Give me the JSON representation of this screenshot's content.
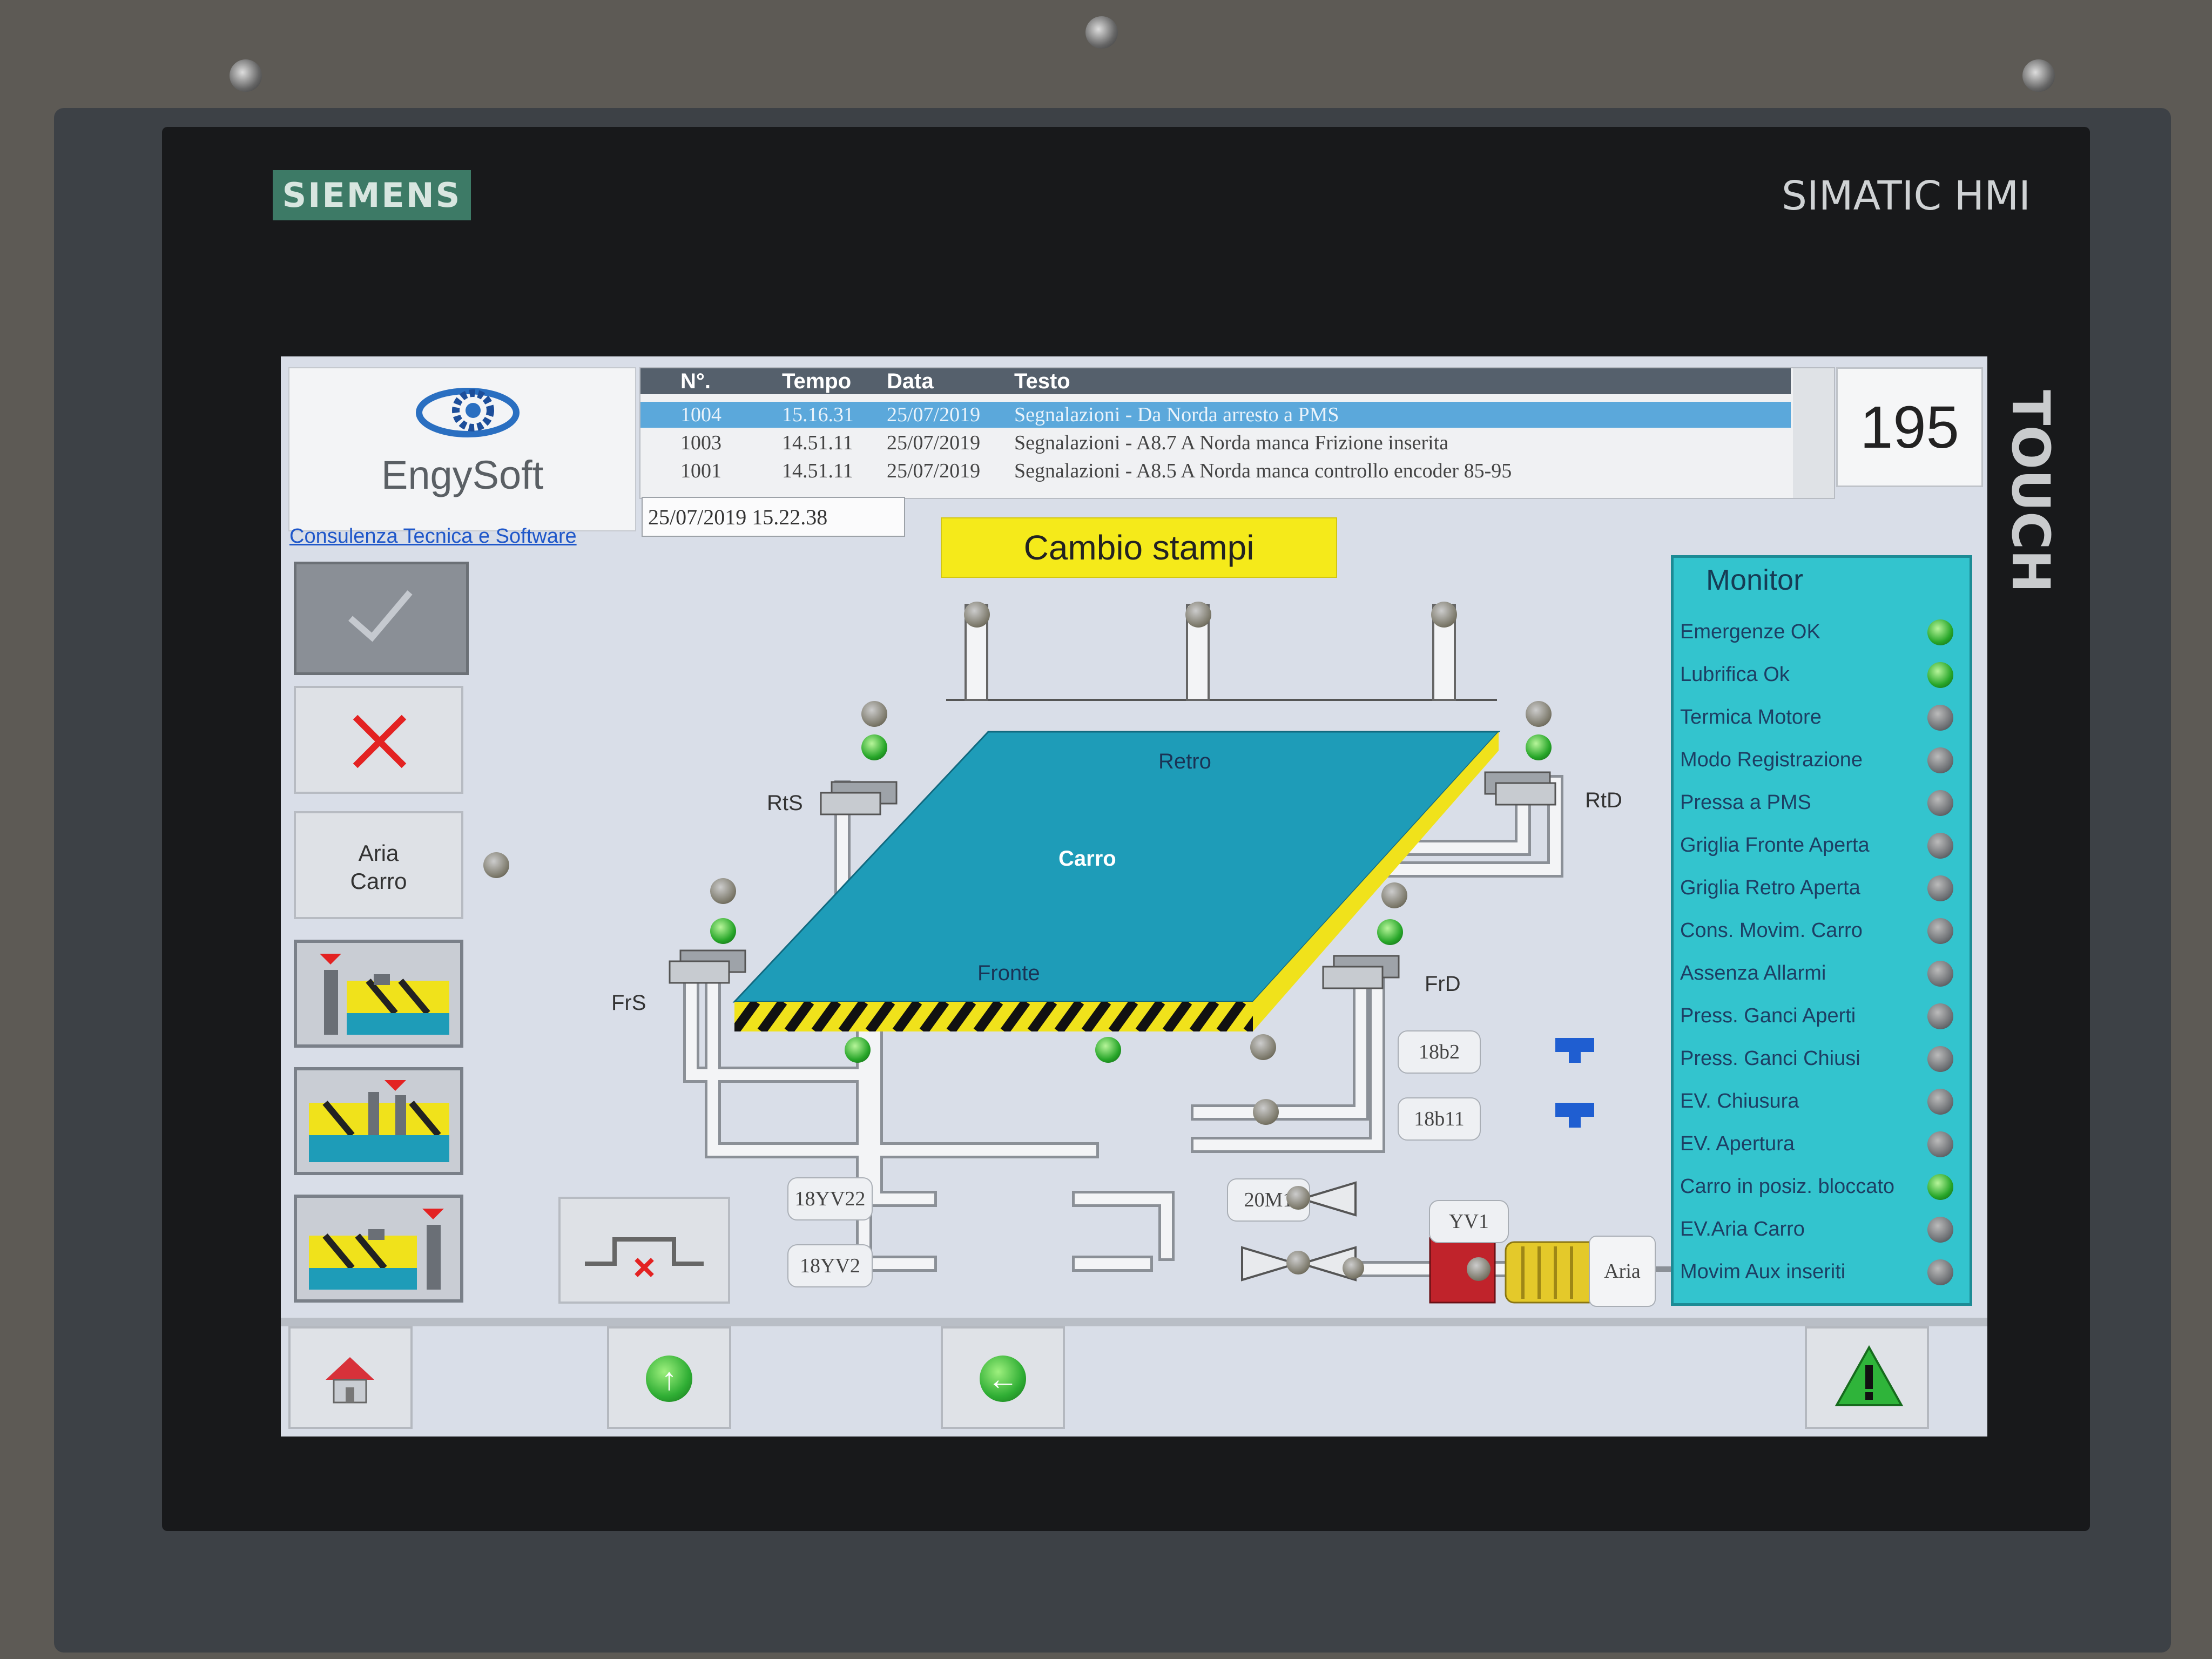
{
  "device": {
    "brand": "SIEMENS",
    "model": "SIMATIC HMI",
    "touch_label": "TOUCH"
  },
  "logo": {
    "name": "EngySoft",
    "subtitle": "Consulenza Tecnica e Software"
  },
  "alarms": {
    "headers": [
      "N°.",
      "Tempo",
      "Data",
      "Testo"
    ],
    "rows": [
      {
        "no": "1004",
        "time": "15.16.31",
        "date": "25/07/2019",
        "text": "Segnalazioni - Da Norda arresto a PMS",
        "selected": true
      },
      {
        "no": "1003",
        "time": "14.51.11",
        "date": "25/07/2019",
        "text": "Segnalazioni - A8.7 A Norda manca Frizione inserita",
        "selected": false
      },
      {
        "no": "1001",
        "time": "14.51.11",
        "date": "25/07/2019",
        "text": "Segnalazioni - A8.5 A Norda manca controllo encoder 85-95",
        "selected": false
      }
    ]
  },
  "counter": "195",
  "datetime": "25/07/2019 15.22.38",
  "page_title": "Cambio stampi",
  "left_buttons": {
    "aria_carro": [
      "Aria",
      "Carro"
    ]
  },
  "diagram": {
    "plate": {
      "back": "Retro",
      "center": "Carro",
      "front": "Fronte"
    },
    "corners": {
      "rear_left": "RtS",
      "rear_right": "RtD",
      "front_left": "FrS",
      "front_right": "FrD"
    },
    "tags": {
      "t18b2": "18b2",
      "t18b11": "18b11",
      "t18YV22": "18YV22",
      "t18YV2": "18YV2",
      "t20M1": "20M1",
      "tYV1": "YV1",
      "aria": "Aria"
    }
  },
  "monitor": {
    "title": "Monitor",
    "items": [
      {
        "label": "Emergenze OK",
        "on": true
      },
      {
        "label": "Lubrifica Ok",
        "on": true
      },
      {
        "label": "Termica Motore",
        "on": false
      },
      {
        "label": "Modo Registrazione",
        "on": false
      },
      {
        "label": "Pressa a PMS",
        "on": false
      },
      {
        "label": "Griglia Fronte Aperta",
        "on": false
      },
      {
        "label": "Griglia Retro Aperta",
        "on": false
      },
      {
        "label": "Cons. Movim. Carro",
        "on": false
      },
      {
        "label": "Assenza Allarmi",
        "on": false
      },
      {
        "label": "Press. Ganci Aperti",
        "on": false
      },
      {
        "label": "Press. Ganci Chiusi",
        "on": false
      },
      {
        "label": "EV. Chiusura",
        "on": false
      },
      {
        "label": "EV. Apertura",
        "on": false
      },
      {
        "label": "Carro in posiz. bloccato",
        "on": true
      },
      {
        "label": "EV.Aria Carro",
        "on": false
      },
      {
        "label": "Movim Aux inseriti",
        "on": false
      }
    ]
  },
  "colors": {
    "plate": "#1e9cb8",
    "monitor_bg": "#33c4ce",
    "title_bg": "#f5ea1a",
    "led_on": "#27a629",
    "led_off": "#6b6e72",
    "selected_row": "#5ba8db"
  },
  "icons": {
    "home": "home-icon",
    "up": "arrow-up-icon",
    "left": "arrow-left-icon",
    "warning": "warning-icon",
    "confirm": "check-icon",
    "cancel": "cross-icon"
  }
}
